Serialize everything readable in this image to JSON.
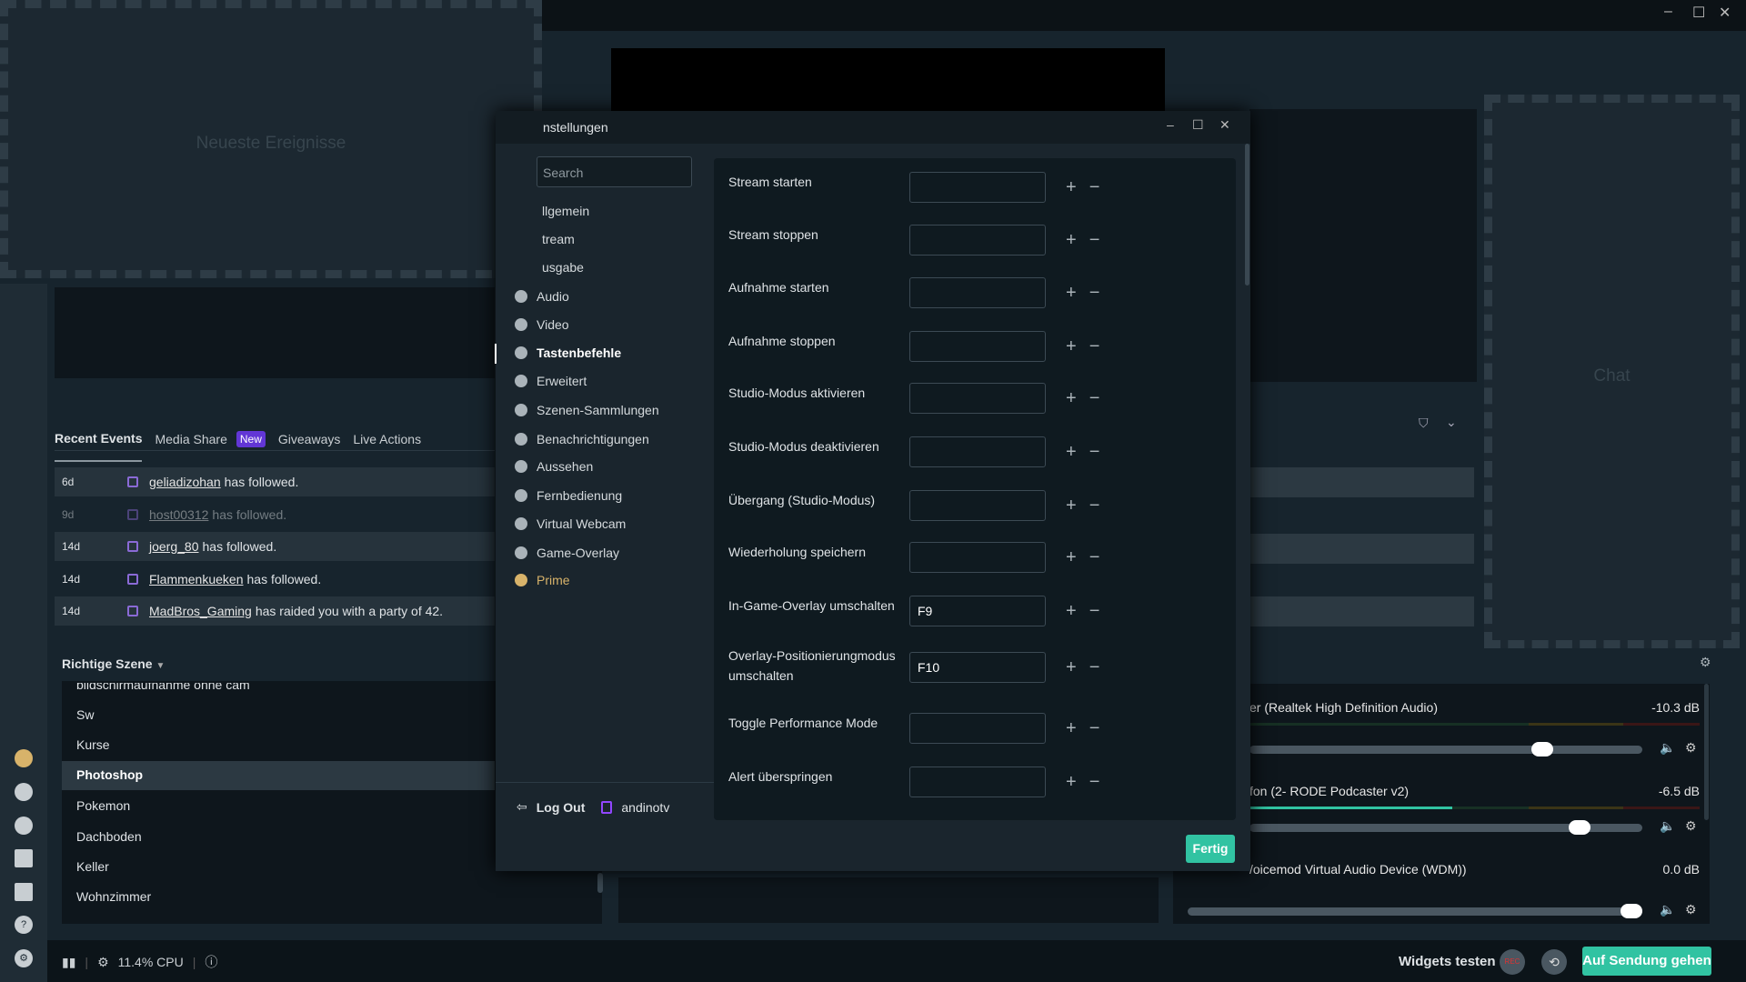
{
  "left_panel": {
    "placeholder": "Neueste Ereignisse"
  },
  "chat": {
    "placeholder": "Chat"
  },
  "tabs": [
    {
      "label": "Recent Events"
    },
    {
      "label": "Media Share"
    },
    {
      "label": "Giveaways"
    },
    {
      "label": "Live Actions"
    }
  ],
  "badge_new": "New",
  "events": [
    {
      "age": "6d",
      "user": "geliadizohan",
      "text": "has followed."
    },
    {
      "age": "9d",
      "user": "host00312",
      "text": "has followed."
    },
    {
      "age": "14d",
      "user": "joerg_80",
      "text": "has followed."
    },
    {
      "age": "14d",
      "user": "Flammenkueken",
      "text": "has followed."
    },
    {
      "age": "14d",
      "user": "MadBros_Gaming",
      "text": "has raided you with a party of 42."
    }
  ],
  "scenes": {
    "title": "Richtige Szene",
    "items": [
      "bildschirmaufnahme ohne cam",
      "Sw",
      "Kurse",
      "Photoshop",
      "Pokemon",
      "Dachboden",
      "Keller",
      "Wohnzimmer"
    ],
    "selected": "Photoshop"
  },
  "settings": {
    "title": "nstellungen",
    "search_placeholder": "Search",
    "nav": [
      "llgemein",
      "tream",
      "usgabe",
      "Audio",
      "Video",
      "Tastenbefehle",
      "Erweitert",
      "Szenen-Sammlungen",
      "Benachrichtigungen",
      "Aussehen",
      "Fernbedienung",
      "Virtual Webcam",
      "Game-Overlay",
      "Prime"
    ],
    "active": "Tastenbefehle",
    "logout": "Log Out",
    "user": "andinotv",
    "hotkeys": [
      {
        "label": "Stream starten",
        "value": ""
      },
      {
        "label": "Stream stoppen",
        "value": ""
      },
      {
        "label": "Aufnahme starten",
        "value": ""
      },
      {
        "label": "Aufnahme stoppen",
        "value": ""
      },
      {
        "label": "Studio-Modus aktivieren",
        "value": ""
      },
      {
        "label": "Studio-Modus deaktivieren",
        "value": ""
      },
      {
        "label": "Übergang (Studio-Modus)",
        "value": ""
      },
      {
        "label": "Wiederholung speichern",
        "value": ""
      },
      {
        "label": "In-Game-Overlay umschalten",
        "value": "F9"
      },
      {
        "label": "Overlay-Positionierungmodus umschalten",
        "value": "F10"
      },
      {
        "label": "Toggle Performance Mode",
        "value": ""
      },
      {
        "label": "Alert überspringen",
        "value": ""
      }
    ],
    "done": "Fertig"
  },
  "mixer": [
    {
      "name": "er (Realtek High Definition Audio)",
      "db": "-10.3 dB",
      "volume": 0.76
    },
    {
      "name": "fon (2- RODE Podcaster v2)",
      "db": "-6.5 dB",
      "volume": 0.86,
      "level": 0.45
    },
    {
      "name": "/oicemod Virtual Audio Device (WDM))",
      "db": "0.0 dB",
      "volume": 1.0
    }
  ],
  "footer": {
    "cpu": "11.4% CPU",
    "widgets": "Widgets testen",
    "rec": "REC",
    "go_live": "Auf Sendung gehen"
  },
  "colors": {
    "accent": "#31c3a2",
    "twitch": "#9146ff",
    "prime": "#d8b36a"
  }
}
